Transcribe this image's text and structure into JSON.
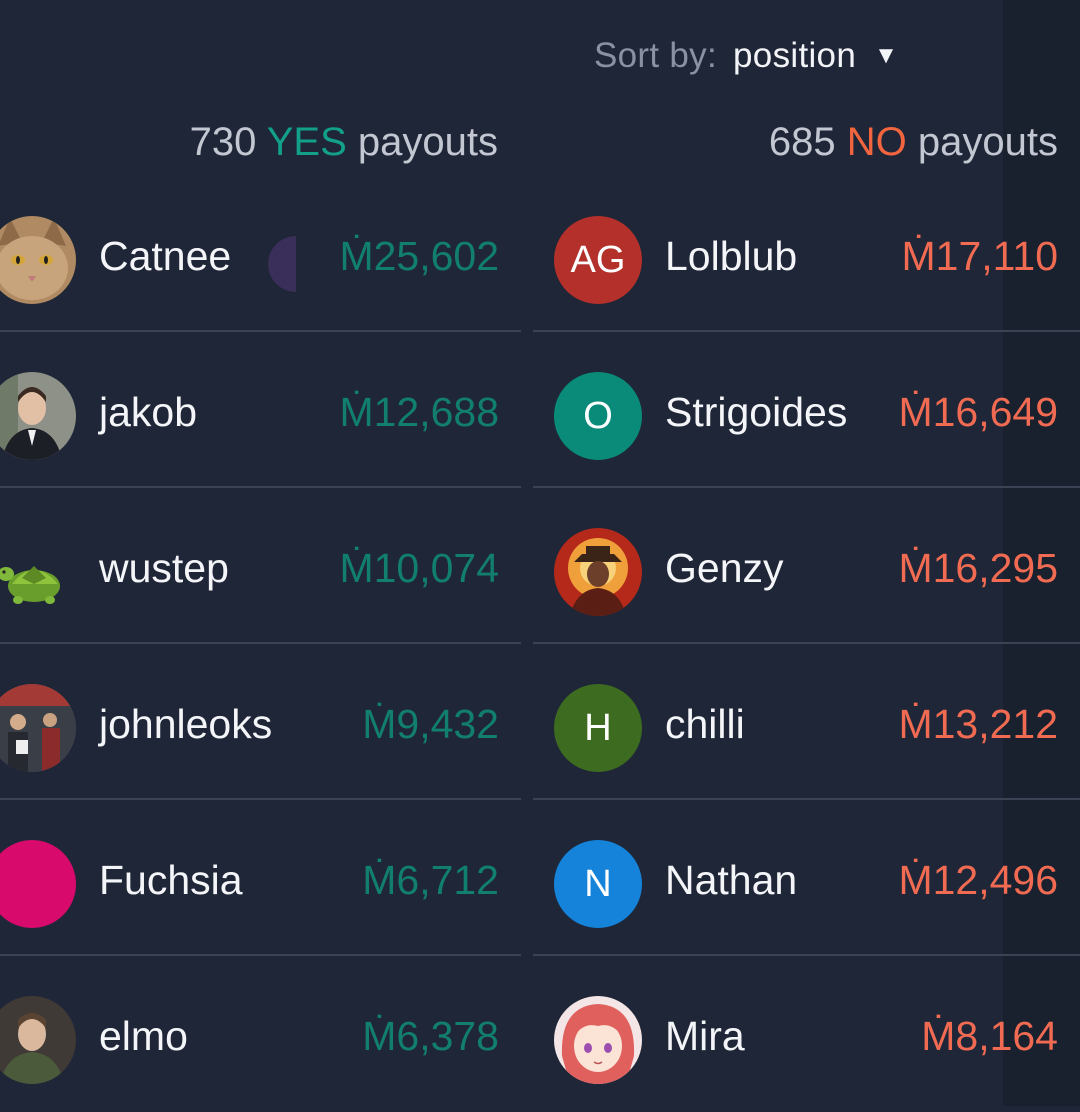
{
  "sort": {
    "label": "Sort by:",
    "value": "position",
    "caret": "▼"
  },
  "yes_header": {
    "count": "730",
    "side": "YES",
    "suffix": "payouts"
  },
  "no_header": {
    "count": "685",
    "side": "NO",
    "suffix": "payouts"
  },
  "yes_rows": [
    {
      "name": "Catnee",
      "amount": "Ṁ25,602",
      "avatar": "cat-photo"
    },
    {
      "name": "jakob",
      "amount": "Ṁ12,688",
      "avatar": "portrait-photo"
    },
    {
      "name": "wustep",
      "amount": "Ṁ10,074",
      "avatar": "turtle-emoji"
    },
    {
      "name": "johnleoks",
      "amount": "Ṁ9,432",
      "avatar": "group-photo"
    },
    {
      "name": "Fuchsia",
      "amount": "Ṁ6,712",
      "avatar": "fuchsia-circle"
    },
    {
      "name": "elmo",
      "amount": "Ṁ6,378",
      "avatar": "portrait-photo"
    }
  ],
  "no_rows": [
    {
      "name": "Lolblub",
      "amount": "Ṁ17,110",
      "initials": "AG",
      "color": "#b3302b"
    },
    {
      "name": "Strigoides",
      "amount": "Ṁ16,649",
      "initials": "O",
      "color": "#0a8b7a"
    },
    {
      "name": "Genzy",
      "amount": "Ṁ16,295",
      "avatar": "explosion-cowboy"
    },
    {
      "name": "chilli",
      "amount": "Ṁ13,212",
      "initials": "H",
      "color": "#3d6b1f"
    },
    {
      "name": "Nathan",
      "amount": "Ṁ12,496",
      "initials": "N",
      "color": "#1483d9"
    },
    {
      "name": "Mira",
      "amount": "Ṁ8,164",
      "avatar": "anime-girl"
    }
  ],
  "colors": {
    "background": "#1f2637",
    "yes": "#12a08a",
    "no": "#f2653f"
  }
}
